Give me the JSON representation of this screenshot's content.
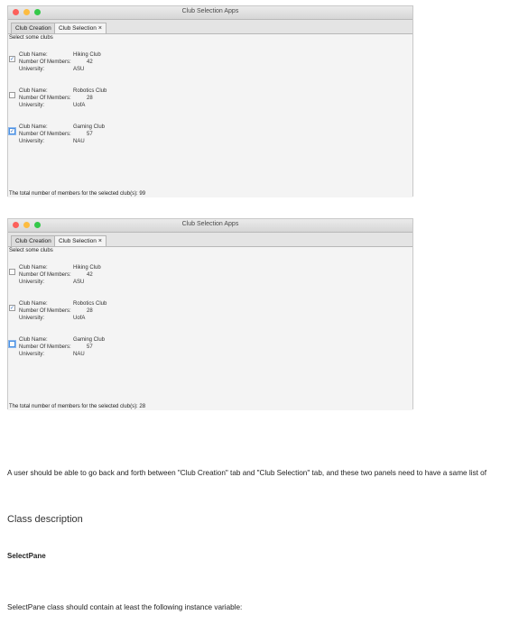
{
  "window1": {
    "title": "Club Selection Apps",
    "tabs": [
      {
        "label": "Club Creation"
      },
      {
        "label": "Club Selection",
        "close": "×"
      }
    ],
    "instruction": "Select some clubs",
    "labels": {
      "name": "Club Name:",
      "members": "Number Of Members:",
      "university": "University:"
    },
    "clubs": [
      {
        "name": "Hiking Club",
        "members": "42",
        "university": "ASU",
        "checked": true
      },
      {
        "name": "Robotics Club",
        "members": "28",
        "university": "UofA",
        "checked": false
      },
      {
        "name": "Gaming Club",
        "members": "57",
        "university": "NAU",
        "checked": true
      }
    ],
    "total": "The total number of members for the selected club(s): 99"
  },
  "window2": {
    "title": "Club Selection Apps",
    "tabs": [
      {
        "label": "Club Creation"
      },
      {
        "label": "Club Selection",
        "close": "×"
      }
    ],
    "instruction": "Select some clubs",
    "labels": {
      "name": "Club Name:",
      "members": "Number Of Members:",
      "university": "University:"
    },
    "clubs": [
      {
        "name": "Hiking Club",
        "members": "42",
        "university": "ASU",
        "checked": false
      },
      {
        "name": "Robotics Club",
        "members": "28",
        "university": "UofA",
        "checked": true
      },
      {
        "name": "Gaming Club",
        "members": "57",
        "university": "NAU",
        "checked": false,
        "focused": true
      }
    ],
    "total": "The total number of members for the selected club(s): 28"
  },
  "doc": {
    "paragraph": "A user should be able to go back and forth between \"Club Creation\" tab and \"Club Selection\" tab, and these two panels need to have a same list of",
    "heading": "Class description",
    "subheading": "SelectPane",
    "paragraph2": "SelectPane class should contain at least the following instance variable:"
  },
  "icons": {
    "check": "✓"
  }
}
